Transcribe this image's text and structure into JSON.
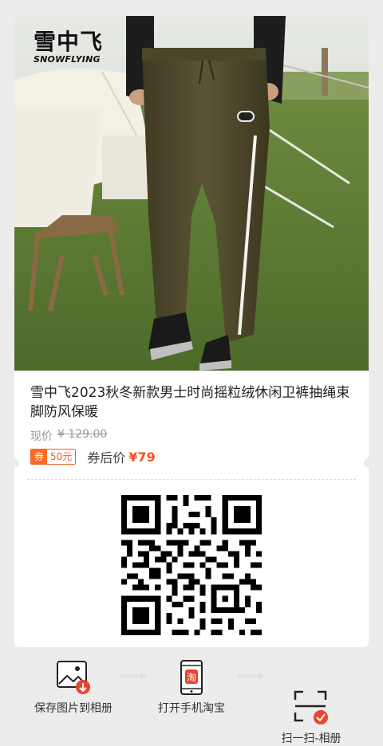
{
  "brand": {
    "name_cn": "雪中飞",
    "name_en": "SNOWFLYING"
  },
  "product": {
    "title": "雪中飞2023秋冬新款男士时尚摇粒绒休闲卫裤抽绳束脚防风保暖",
    "current_price_label": "现价",
    "original_price": "¥ 129.00",
    "coupon_badge": "券",
    "coupon_amount": "50元",
    "after_coupon_label": "券后价",
    "after_coupon_price": "¥79"
  },
  "actions": [
    {
      "label": "保存图片到相册",
      "icon": "image-download-icon"
    },
    {
      "label": "打开手机淘宝",
      "icon": "phone-taobao-icon",
      "icon_text": "淘"
    },
    {
      "label": "扫一扫-相册\n选取该图片",
      "icon": "scan-frame-icon"
    }
  ],
  "colors": {
    "accent": "#ff5a1f",
    "badge_red": "#e8442e",
    "background": "#ececec",
    "card": "#ffffff"
  }
}
